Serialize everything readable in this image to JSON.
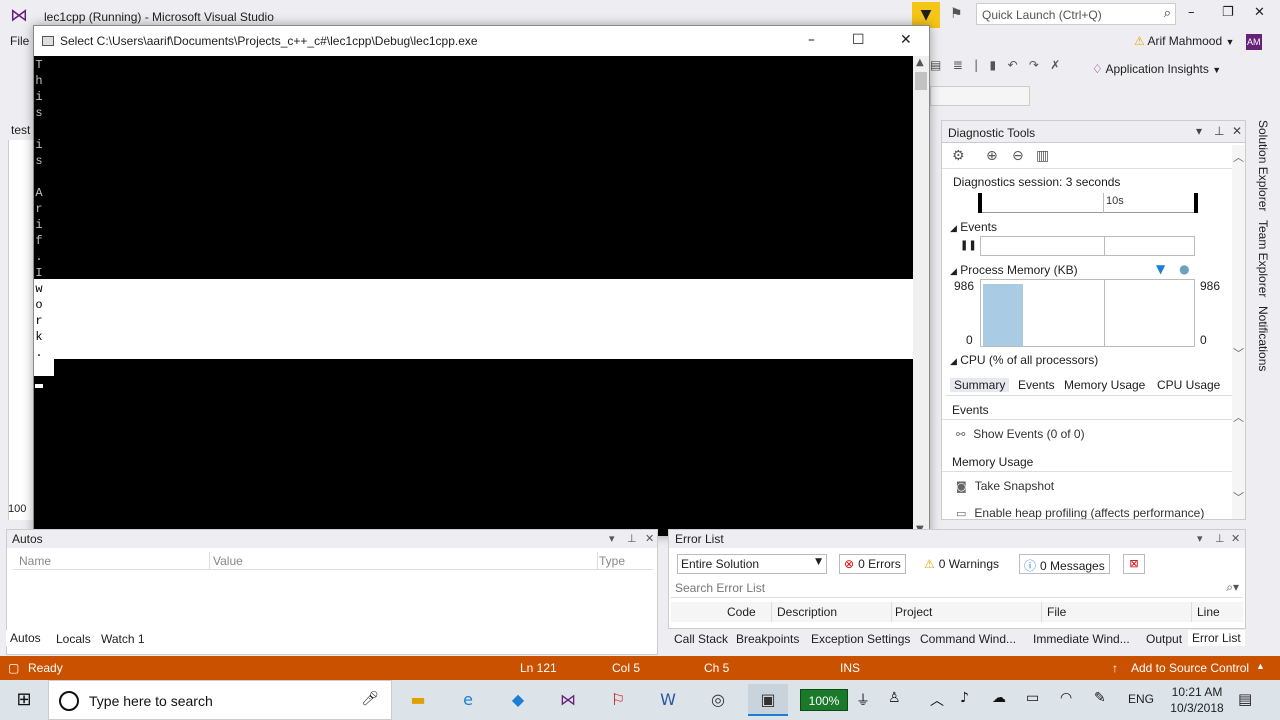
{
  "vs": {
    "title": "lec1cpp (Running) - Microsoft Visual Studio",
    "quick_launch_placeholder": "Quick Launch (Ctrl+Q)",
    "menu_file": "File",
    "user_name": "Arif Mahmood",
    "user_initials": "AM",
    "app_insights": "Application Insights",
    "editor_tab_fragment": "test",
    "zoom_fragment": "100"
  },
  "console": {
    "title": "Select C:\\Users\\aarif\\Documents\\Projects_c++_c#\\lec1cpp\\Debug\\lec1cpp.exe",
    "output_chars": [
      "T",
      "h",
      "i",
      "s",
      "",
      "i",
      "s",
      "",
      "A",
      "r",
      "i",
      "f",
      ".",
      "I",
      "w",
      "o",
      "r",
      "k",
      "."
    ]
  },
  "diagnostics": {
    "title": "Diagnostic Tools",
    "session": "Diagnostics session: 3 seconds",
    "timeline_label": "10s",
    "events_header": "Events",
    "process_memory_header": "Process Memory (KB)",
    "mem_max": "986",
    "mem_min": "0",
    "cpu_header": "CPU (% of all processors)",
    "tabs": [
      "Summary",
      "Events",
      "Memory Usage",
      "CPU Usage"
    ],
    "selected_tab": "Summary",
    "events_section": "Events",
    "show_events": "Show Events (0 of 0)",
    "memory_section": "Memory Usage",
    "take_snapshot": "Take Snapshot",
    "heap_profiling": "Enable heap profiling (affects performance)"
  },
  "side_tabs": [
    "Solution Explorer",
    "Team Explorer",
    "Notifications"
  ],
  "autos": {
    "title": "Autos",
    "columns": [
      "Name",
      "Value",
      "Type"
    ]
  },
  "bottom_left_tabs": [
    "Autos",
    "Locals",
    "Watch 1"
  ],
  "error_list": {
    "title": "Error List",
    "scope": "Entire Solution",
    "errors": "0 Errors",
    "warnings": "0 Warnings",
    "messages": "0 Messages",
    "search_placeholder": "Search Error List",
    "columns": [
      "Code",
      "Description",
      "Project",
      "File",
      "Line"
    ]
  },
  "bottom_right_tabs": [
    "Call Stack",
    "Breakpoints",
    "Exception Settings",
    "Command Wind...",
    "Immediate Wind...",
    "Output",
    "Error List"
  ],
  "status": {
    "ready": "Ready",
    "line": "Ln 121",
    "col": "Col 5",
    "ch": "Ch 5",
    "mode": "INS",
    "source_control": "Add to Source Control"
  },
  "taskbar": {
    "search_placeholder": "Type here to search",
    "battery": "100%",
    "language": "ENG",
    "time": "10:21 AM",
    "date": "10/3/2018"
  },
  "colors": {
    "status_bar": "#ca5100",
    "console_bg": "#000000",
    "vs_accent": "#68217a"
  }
}
